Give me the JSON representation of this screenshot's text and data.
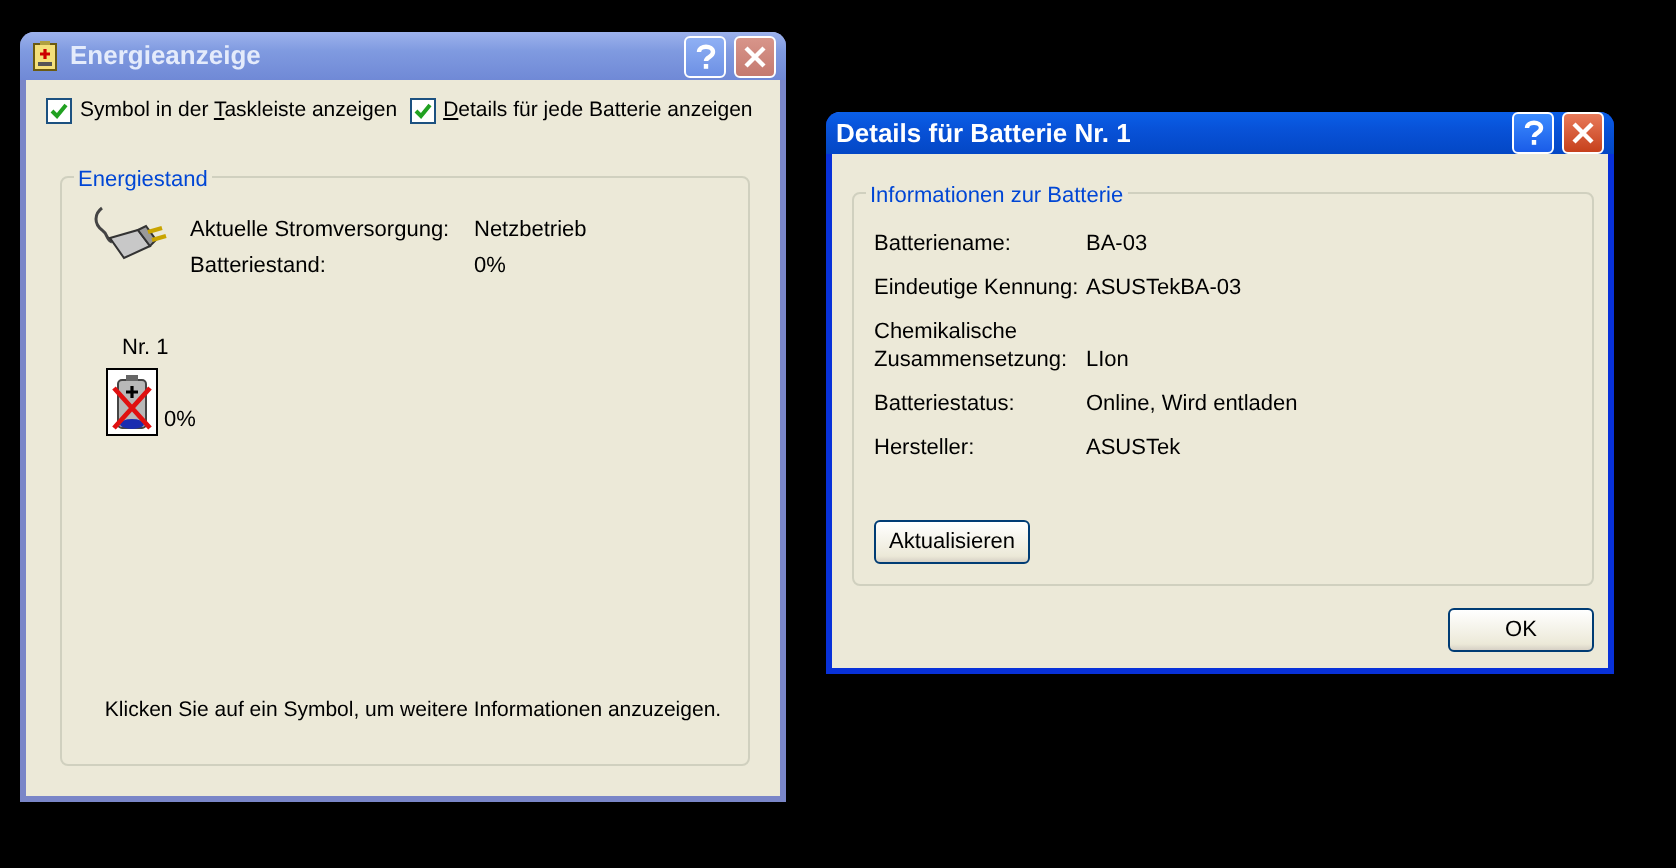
{
  "power_window": {
    "title": "Energieanzeige",
    "checkboxes": [
      {
        "label_before": "Symbol in der ",
        "access_key": "T",
        "label_after": "askleiste anzeigen",
        "checked": true
      },
      {
        "access_key": "D",
        "label_after": "etails für jede Batterie anzeigen",
        "checked": true
      }
    ],
    "group": {
      "legend": "Energiestand",
      "rows": [
        {
          "label": "Aktuelle Stromversorgung:",
          "value": "Netzbetrieb"
        },
        {
          "label": "Batteriestand:",
          "value": "0%"
        }
      ],
      "batteries": [
        {
          "name": "Nr. 1",
          "charge": "0%"
        }
      ],
      "hint": "Klicken Sie auf ein Symbol, um weitere Informationen anzuzeigen."
    }
  },
  "details_window": {
    "title": "Details für Batterie Nr. 1",
    "group": {
      "legend": "Informationen zur Batterie",
      "rows": [
        {
          "label": "Batteriename:",
          "value": "BA-03"
        },
        {
          "label": "Eindeutige Kennung:",
          "value": "ASUSTekBA-03"
        },
        {
          "label": "Chemikalische Zusammensetzung:",
          "value": "LIon"
        },
        {
          "label": "Batteriestatus:",
          "value": "Online, Wird entladen"
        },
        {
          "label": "Hersteller:",
          "value": "ASUSTek"
        }
      ],
      "refresh_button": "Aktualisieren"
    },
    "ok_button": "OK"
  }
}
